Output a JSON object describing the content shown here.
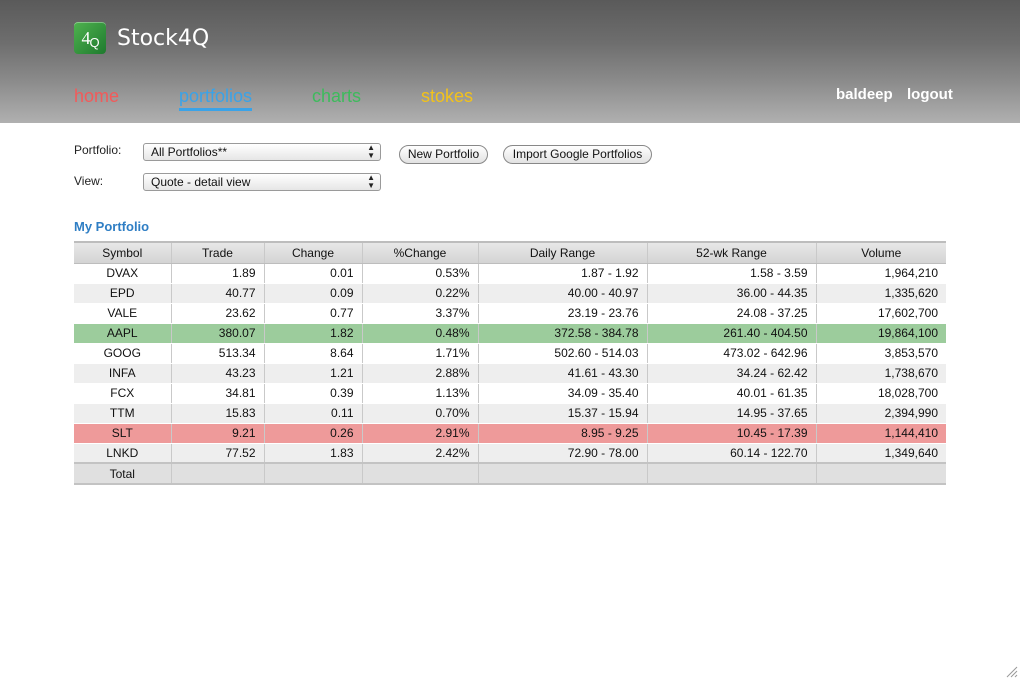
{
  "app": {
    "logo_main": "4",
    "logo_sub": "Q",
    "brand": "Stock4Q"
  },
  "nav": {
    "home": "home",
    "portfolios": "portfolios",
    "charts": "charts",
    "stokes": "stokes"
  },
  "user": {
    "name": "baldeep",
    "logout": "logout"
  },
  "controls": {
    "portfolio_label": "Portfolio:",
    "portfolio_value": "All Portfolios**",
    "view_label": "View:",
    "view_value": "Quote - detail view",
    "new_portfolio": "New Portfolio",
    "import_google": "Import Google Portfolios"
  },
  "section_title": "My Portfolio",
  "table": {
    "headers": [
      "Symbol",
      "Trade",
      "Change",
      "%Change",
      "Daily Range",
      "52-wk Range",
      "Volume"
    ],
    "rows": [
      [
        "DVAX",
        "1.89",
        "0.01",
        "0.53%",
        "1.87 - 1.92",
        "1.58 - 3.59",
        "1,964,210"
      ],
      [
        "EPD",
        "40.77",
        "0.09",
        "0.22%",
        "40.00 - 40.97",
        "36.00 - 44.35",
        "1,335,620"
      ],
      [
        "VALE",
        "23.62",
        "0.77",
        "3.37%",
        "23.19 - 23.76",
        "24.08 - 37.25",
        "17,602,700"
      ],
      [
        "AAPL",
        "380.07",
        "1.82",
        "0.48%",
        "372.58 - 384.78",
        "261.40 - 404.50",
        "19,864,100"
      ],
      [
        "GOOG",
        "513.34",
        "8.64",
        "1.71%",
        "502.60 - 514.03",
        "473.02 - 642.96",
        "3,853,570"
      ],
      [
        "INFA",
        "43.23",
        "1.21",
        "2.88%",
        "41.61 - 43.30",
        "34.24 - 62.42",
        "1,738,670"
      ],
      [
        "FCX",
        "34.81",
        "0.39",
        "1.13%",
        "34.09 - 35.40",
        "40.01 - 61.35",
        "18,028,700"
      ],
      [
        "TTM",
        "15.83",
        "0.11",
        "0.70%",
        "15.37 - 15.94",
        "14.95 - 37.65",
        "2,394,990"
      ],
      [
        "SLT",
        "9.21",
        "0.26",
        "2.91%",
        "8.95 - 9.25",
        "10.45 - 17.39",
        "1,144,410"
      ],
      [
        "LNKD",
        "77.52",
        "1.83",
        "2.42%",
        "72.90 - 78.00",
        "60.14 - 122.70",
        "1,349,640"
      ]
    ],
    "row_highlight": [
      "",
      "",
      "",
      "up",
      "",
      "",
      "",
      "",
      "down",
      ""
    ],
    "total_label": "Total"
  },
  "colors": {
    "home": "#f25a5a",
    "portfolios": "#3aa3e8",
    "charts": "#3dbb5c",
    "stokes": "#f2c21a",
    "row_up": "#9ccc9c",
    "row_down": "#ee9a9a",
    "section_title": "#2f7ec4"
  },
  "icons": {
    "logo": "stock4q-logo-icon",
    "select_arrow": "updown-arrow-icon",
    "resize": "resize-grip-icon"
  }
}
